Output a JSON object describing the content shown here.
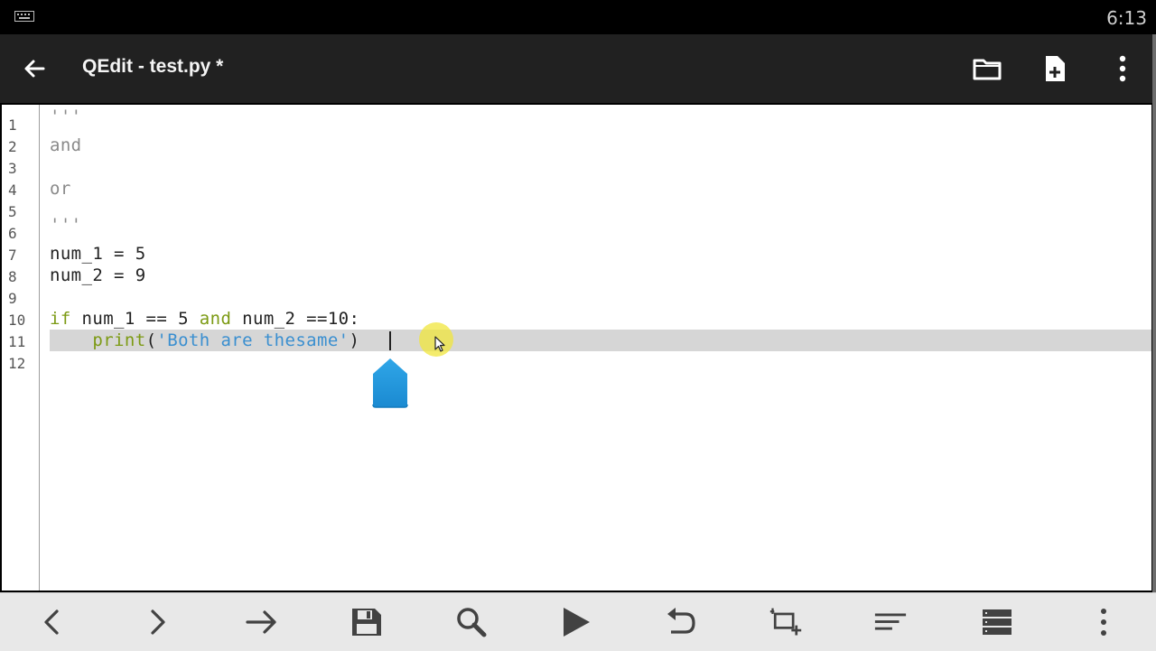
{
  "status_bar": {
    "time": "6:13",
    "keyboard_icon": "keyboard-icon"
  },
  "app_bar": {
    "title": "QEdit - test.py *",
    "back_icon": "arrow-back-icon",
    "actions": [
      "folder-icon",
      "new-file-icon",
      "overflow-menu-icon"
    ]
  },
  "editor": {
    "line_numbers": [
      "1",
      "2",
      "3",
      "4",
      "5",
      "6",
      "7",
      "8",
      "9",
      "10",
      "11",
      "12"
    ],
    "lines": {
      "l1": "'''",
      "l2": "and",
      "l3": "",
      "l4": "or",
      "l5": "",
      "l6": "'''",
      "l7": "num_1 = 5",
      "l8": "num_2 = 9",
      "l9": "",
      "l10_if": "if",
      "l10_a": " num_1 == 5 ",
      "l10_and": "and",
      "l10_b": " num_2 ==10:",
      "l11_indent": "    ",
      "l11_print": "print",
      "l11_open": "(",
      "l11_str": "'Both are thesame'",
      "l11_close": ")",
      "l12": ""
    },
    "syntax_colors": {
      "comment": "#8a8a8a",
      "keyword": "#7c9a14",
      "string": "#3a8fd0"
    },
    "current_line": 11
  },
  "bottom_bar": {
    "buttons": [
      "chevron-left-icon",
      "chevron-right-icon",
      "arrow-right-icon",
      "save-icon",
      "search-icon",
      "run-icon",
      "undo-icon",
      "add-tab-icon",
      "format-icon",
      "list-icon",
      "more-icon"
    ]
  }
}
